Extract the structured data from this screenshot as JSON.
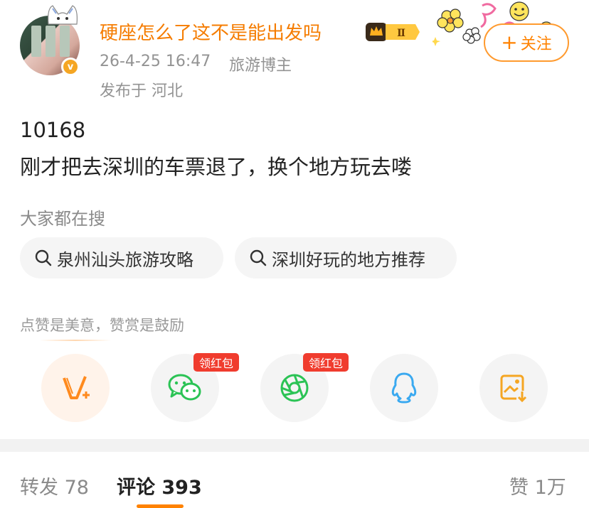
{
  "post": {
    "user": {
      "name": "硬座怎么了这不是能出发吗",
      "level_badge": "Ⅱ",
      "verified_mark": "v"
    },
    "meta": {
      "time": "26-4-25 16:47",
      "role": "旅游博主",
      "location": "发布于 河北"
    },
    "follow_button": {
      "plus": "+",
      "label": "关注"
    },
    "content": {
      "line1": "10168",
      "line2": "刚才把去深圳的车票退了，换个地方玩去喽"
    }
  },
  "search": {
    "title": "大家都在搜",
    "chips": [
      {
        "label": "泉州汕头旅游攻略"
      },
      {
        "label": "深圳好玩的地方推荐"
      }
    ]
  },
  "reward": {
    "text": "点赞是美意，赞赏是鼓励"
  },
  "share": {
    "items": [
      {
        "icon": "reward-v-icon"
      },
      {
        "icon": "wechat-icon",
        "tag": "领红包"
      },
      {
        "icon": "moments-icon",
        "tag": "领红包"
      },
      {
        "icon": "qq-icon"
      },
      {
        "icon": "save-image-icon"
      }
    ]
  },
  "tabs": {
    "repost": "转发 78",
    "comment": "评论 393",
    "like": "赞 1万"
  },
  "colors": {
    "accent": "#ff8200",
    "username": "#f57c00",
    "red_tag": "#f03c2e",
    "wechat_green": "#2bc355",
    "qq_blue": "#3aa9f0",
    "save_orange": "#f5a623"
  }
}
